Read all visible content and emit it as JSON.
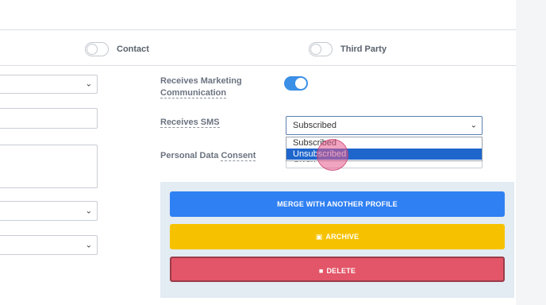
{
  "toggles_row": {
    "contact_label": "Contact",
    "third_party_label": "Third Party"
  },
  "fields": {
    "marketing_label_1": "Receives Marketing",
    "marketing_label_2": "Communication",
    "sms_label": "Receives SMS",
    "consent_label_1": "Personal Data",
    "consent_label_2": "Consent",
    "sms_selected": "Subscribed",
    "sms_options": [
      "Subscribed",
      "Unsubscribed"
    ],
    "consent_peek": "Given"
  },
  "actions": {
    "merge_label": "MERGE WITH ANOTHER PROFILE",
    "archive_label": "ARCHIVE",
    "delete_label": "DELETE"
  },
  "icons": {
    "archive": "archive-icon",
    "delete": "trash-icon",
    "chevron": "chevron-down-icon"
  },
  "colors": {
    "merge": "#2f80f2",
    "archive": "#f6c200",
    "delete": "#e35568",
    "toggle_on": "#3b8fe6"
  }
}
